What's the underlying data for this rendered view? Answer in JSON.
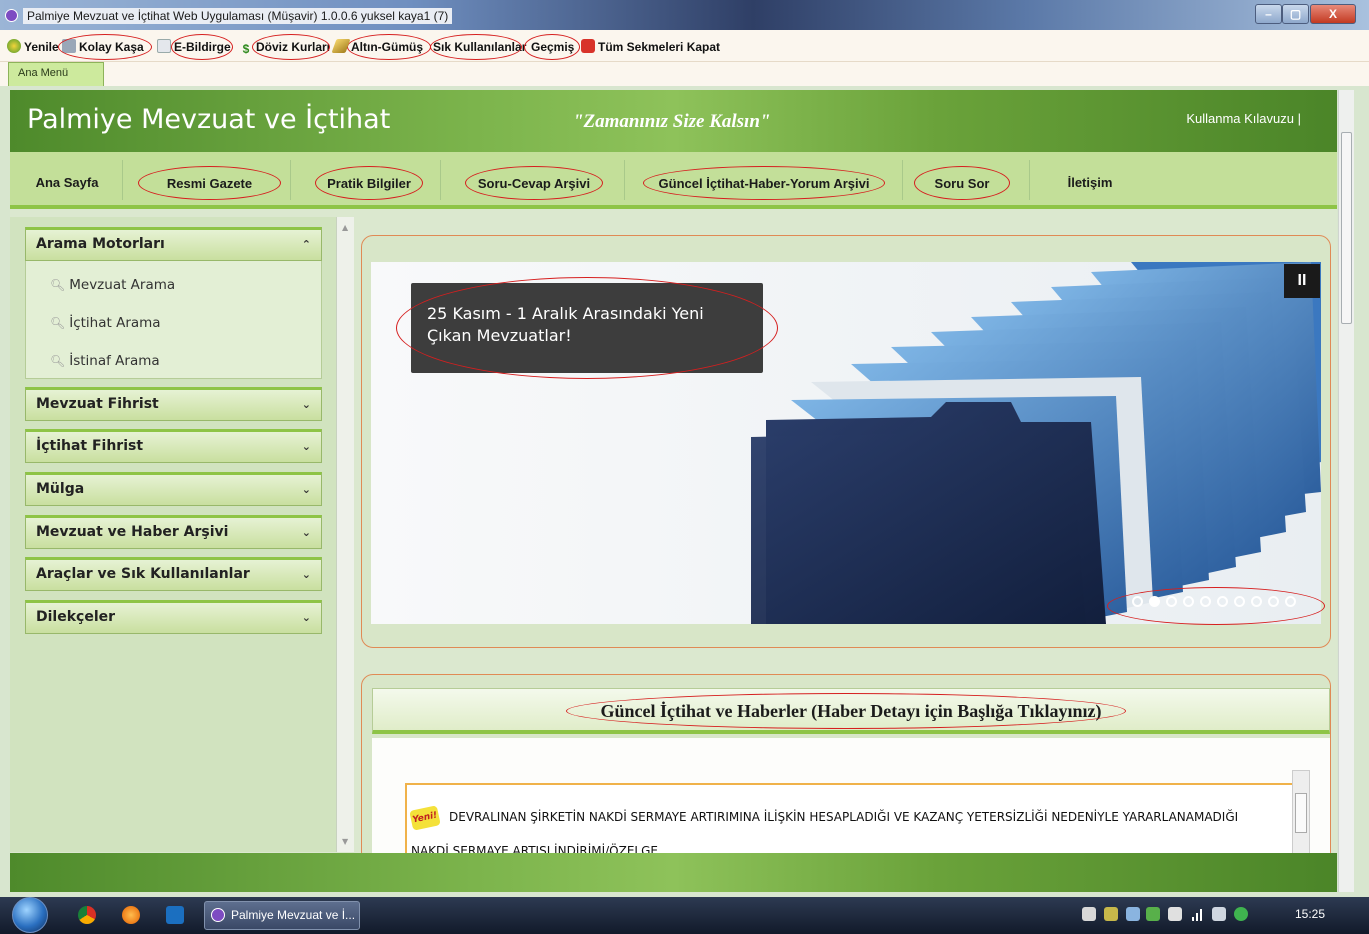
{
  "window": {
    "title": "Palmiye Mevzuat ve İçtihat Web Uygulaması (Müşavir)  1.0.0.6  yuksel kaya1 (7)",
    "btn_min": "–",
    "btn_max": "▢",
    "btn_close": "X"
  },
  "toolbar": {
    "refresh": "Yenile",
    "kolay_kasa": "Kolay Kaşa",
    "e_bildirge": "E-Bildirge",
    "doviz": "Döviz Kurları",
    "altin": "Altın-Gümüş",
    "sik": "Sık Kullanılanlar",
    "gecmis": "Geçmiş",
    "close_all": "Tüm Sekmeleri Kapat"
  },
  "tabs": {
    "main": "Ana Menü"
  },
  "header": {
    "brand": "Palmiye Mevzuat ve İçtihat",
    "slogan": "\"Zamanınız Size Kalsın\"",
    "guide": "Kullanma Kılavuzu |"
  },
  "nav": {
    "home": "Ana Sayfa",
    "gazette": "Resmi Gazete",
    "practical": "Pratik Bilgiler",
    "qa": "Soru-Cevap Arşivi",
    "news_archive": "Güncel İçtihat-Haber-Yorum Arşivi",
    "ask": "Soru Sor",
    "contact": "İletişim"
  },
  "sidebar": {
    "search_engines": "Arama Motorları",
    "search_items": [
      "Mevzuat Arama",
      "İçtihat Arama",
      "İstinaf Arama"
    ],
    "sections": [
      "Mevzuat Fihrist",
      "İçtihat Fihrist",
      "Mülga",
      "Mevzuat ve Haber Arşivi",
      "Araçlar ve Sık Kullanılanlar",
      "Dilekçeler"
    ]
  },
  "slider": {
    "caption": "25 Kasım - 1 Aralık Arasındaki Yeni Çıkan Mevzuatlar!",
    "pause": "II",
    "dots": 10,
    "active_dot": 2
  },
  "news": {
    "heading": "Güncel İçtihat ve Haberler (Haber Detayı için Başlığa Tıklayınız)",
    "badge": "Yeni!",
    "item": "DEVRALINAN ŞİRKETİN NAKDİ SERMAYE ARTIRIMINA İLİŞKİN HESAPLADIĞI VE KAZANÇ YETERSİZLİĞİ NEDENİYLE YARARLANAMADIĞI NAKDİ SERMAYE ARTIŞI İNDİRİMİ/ÖZELGE"
  },
  "taskbar": {
    "app": "Palmiye Mevzuat ve İ...",
    "time": "15:25"
  },
  "colors": {
    "accent": "#8ec446",
    "header_green": "#5a9530",
    "ring": "#d61f1f"
  }
}
